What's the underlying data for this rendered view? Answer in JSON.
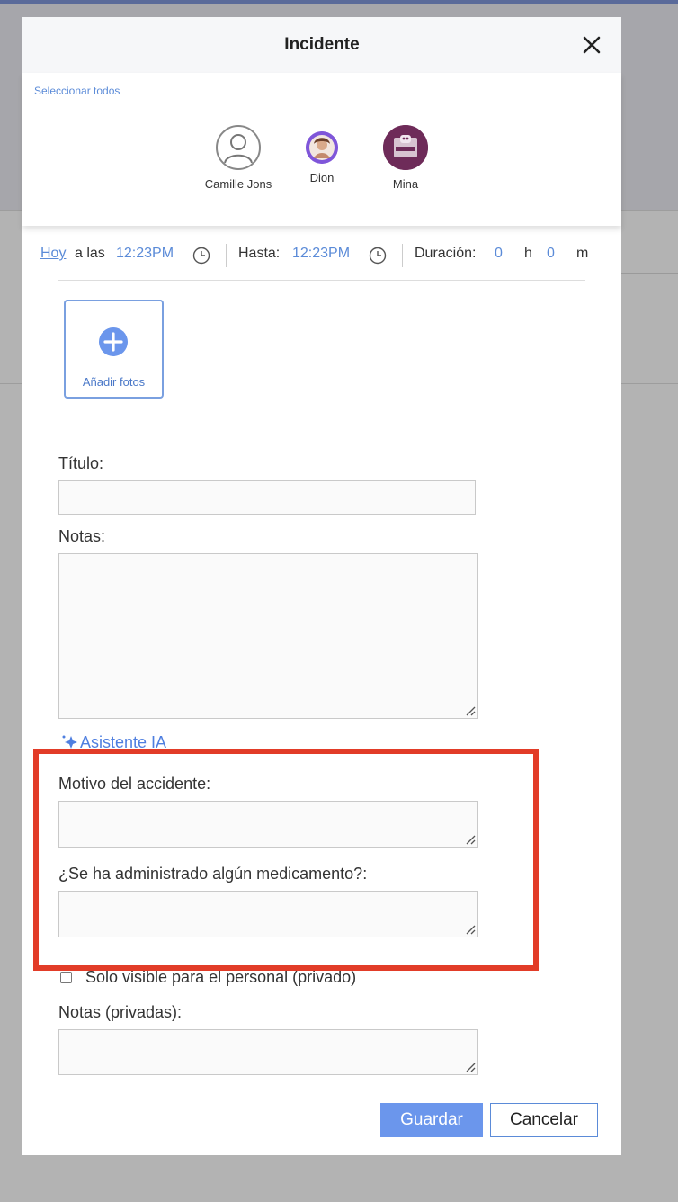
{
  "dialog": {
    "title": "Incidente",
    "select_all": "Seleccionar todos"
  },
  "people": [
    {
      "name": "Camille Jons",
      "avatar": "user-outline-icon"
    },
    {
      "name": "Dion",
      "avatar": "photo"
    },
    {
      "name": "Mina",
      "avatar": "logo"
    }
  ],
  "time": {
    "day": "Hoy",
    "at": "a las",
    "start": "12:23PM",
    "until_label": "Hasta:",
    "end": "12:23PM",
    "duration_label": "Duración:",
    "hours": "0",
    "hours_unit": "h",
    "minutes": "0",
    "minutes_unit": "m"
  },
  "photos": {
    "label": "Añadir fotos"
  },
  "form": {
    "title_label": "Título:",
    "title_value": "",
    "notes_label": "Notas:",
    "notes_value": "",
    "ai_assistant": "Asistente IA",
    "accident_reason_label": "Motivo del accidente:",
    "medication_label": "¿Se ha administrado algún medicamento?:",
    "private_checkbox_label": "Solo visible para el personal (privado)",
    "private_notes_label": "Notas (privadas):"
  },
  "buttons": {
    "save": "Guardar",
    "cancel": "Cancelar"
  },
  "colors": {
    "accent": "#5b8bd8",
    "save_button": "#6b96ec",
    "highlight": "#e23c28"
  }
}
